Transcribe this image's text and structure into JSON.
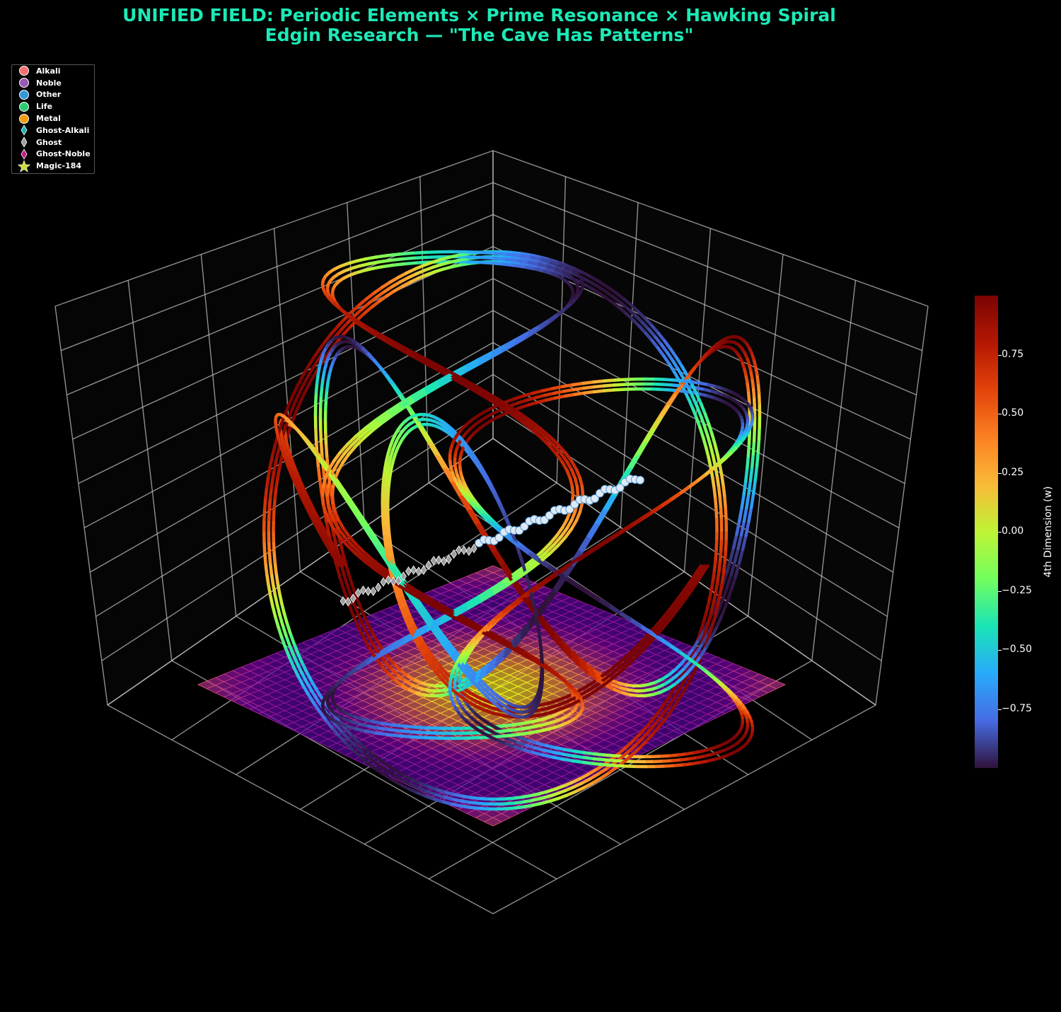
{
  "title_line1": "UNIFIED FIELD: Periodic Elements × Prime Resonance × Hawking Spiral",
  "title_line2": "Edgin Research — \"The Cave Has Patterns\"",
  "legend": [
    {
      "label": "Alkali",
      "marker": "circle",
      "color": "#f07070"
    },
    {
      "label": "Noble",
      "marker": "circle",
      "color": "#9b59b6"
    },
    {
      "label": "Other",
      "marker": "circle",
      "color": "#3498db"
    },
    {
      "label": "Life",
      "marker": "circle",
      "color": "#2ecc71"
    },
    {
      "label": "Metal",
      "marker": "circle",
      "color": "#f39c12"
    },
    {
      "label": "Ghost-Alkali",
      "marker": "diamond",
      "color": "#17b3b3"
    },
    {
      "label": "Ghost",
      "marker": "diamond",
      "color": "#9e9e9e"
    },
    {
      "label": "Ghost-Noble",
      "marker": "diamond",
      "color": "#c71585"
    },
    {
      "label": "Magic-184",
      "marker": "star",
      "color": "#cddc39"
    }
  ],
  "colorbar": {
    "label": "4th Dimension (w)",
    "colormap": "turbo",
    "range": [
      -1.0,
      1.0
    ],
    "ticks": [
      "0.75",
      "0.50",
      "0.25",
      "0.00",
      "−0.25",
      "−0.50",
      "−0.75"
    ],
    "tick_values": [
      0.75,
      0.5,
      0.25,
      0.0,
      -0.25,
      -0.5,
      -0.75
    ]
  },
  "chart_data": {
    "type": "scatter",
    "projection": "3d",
    "title": "UNIFIED FIELD: Periodic Elements × Prime Resonance × Hawking Spiral",
    "subtitle": "Edgin Research — \"The Cave Has Patterns\"",
    "background": "#000000",
    "grid": true,
    "legend_position": "top-left",
    "color_axis": {
      "label": "4th Dimension (w)",
      "range": [
        -1.0,
        1.0
      ],
      "colormap": "turbo"
    },
    "series": [
      {
        "name": "Alkali",
        "type": "scatter"
      },
      {
        "name": "Noble",
        "type": "scatter"
      },
      {
        "name": "Other",
        "type": "scatter"
      },
      {
        "name": "Life",
        "type": "scatter"
      },
      {
        "name": "Metal",
        "type": "scatter"
      },
      {
        "name": "Ghost-Alkali",
        "type": "scatter"
      },
      {
        "name": "Ghost",
        "type": "scatter"
      },
      {
        "name": "Ghost-Noble",
        "type": "scatter"
      },
      {
        "name": "Magic-184",
        "type": "scatter"
      }
    ],
    "surface": {
      "type": "wireframe-surface",
      "colormap": "plasma"
    },
    "curve": {
      "type": "3d-line",
      "color_by": "w"
    }
  }
}
